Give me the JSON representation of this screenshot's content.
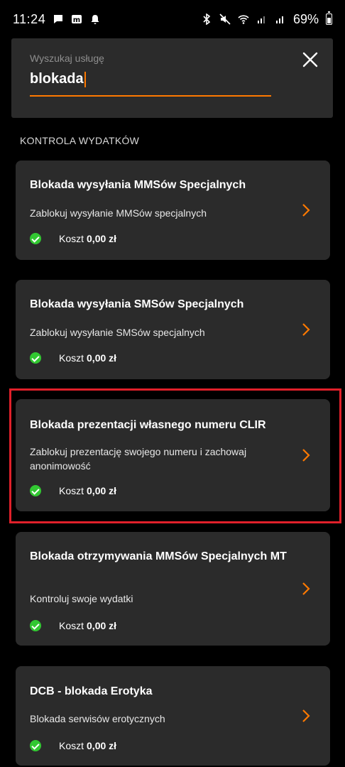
{
  "status_bar": {
    "time": "11:24",
    "battery": "69%"
  },
  "search": {
    "label": "Wyszukaj usługę",
    "value": "blokada"
  },
  "section": {
    "title": "KONTROLA WYDATKÓW"
  },
  "cards": [
    {
      "title": "Blokada wysyłania MMSów Specjalnych",
      "description": "Zablokuj wysyłanie MMSów specjalnych",
      "cost_label": "Koszt",
      "cost_value": "0,00 zł"
    },
    {
      "title": "Blokada wysyłania SMSów Specjalnych",
      "description": "Zablokuj wysyłanie SMSów specjalnych",
      "cost_label": "Koszt",
      "cost_value": "0,00 zł"
    },
    {
      "title": "Blokada prezentacji własnego numeru CLIR",
      "description": "Zablokuj prezentację swojego numeru i zachowaj anonimowość",
      "cost_label": "Koszt",
      "cost_value": "0,00 zł"
    },
    {
      "title": "Blokada otrzymywania MMSów Specjalnych MT",
      "description": "Kontroluj swoje wydatki",
      "cost_label": "Koszt",
      "cost_value": "0,00 zł"
    },
    {
      "title": "DCB - blokada Erotyka",
      "description": "Blokada serwisów erotycznych",
      "cost_label": "Koszt",
      "cost_value": "0,00 zł"
    }
  ],
  "colors": {
    "accent": "#ff7900",
    "check": "#32c832",
    "highlight": "#e0202a",
    "card_bg": "#2b2b2b"
  }
}
